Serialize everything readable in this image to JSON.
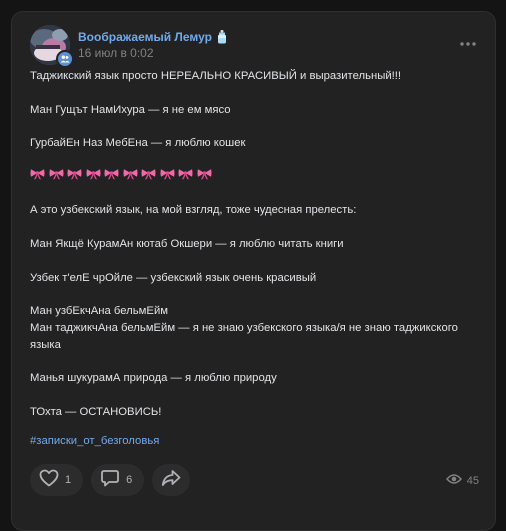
{
  "post": {
    "author": "Воображаемый Лемур",
    "author_emoji": "baby-bottle-icon",
    "date": "16 июл в 0:02",
    "lines": [
      "Таджикский язык просто НЕРЕАЛЬНО КРАСИВЫЙ и выразительный!!!",
      "",
      "Ман Гущът НамИхура — я не ем мясо",
      "",
      "ГурбайЕн Наз МебЕна — я люблю кошек",
      "",
      "",
      "",
      "А это узбекский язык, на мой взгляд, тоже чудесная прелесть:",
      "",
      "Ман Якщё КурамАн кютаб Окшери — я люблю читать книги",
      "",
      "Узбек т'елЕ чрОйле — узбекский язык очень красивый",
      "",
      "Ман узбЕкчАна бельмЕйм",
      "Ман таджикчАна бельмЕйм — я не знаю узбекского языка/я не знаю таджикского языка",
      "",
      "Манья шукурамА природа — я люблю природу",
      "",
      "ТОхта — ОСТАНОВИСЬ!"
    ],
    "bow_emoji": "ribbon-icon",
    "bow_count": 10,
    "hashtag": "#записки_от_безголовья"
  },
  "actions": {
    "likes": "1",
    "comments": "6",
    "views": "45"
  },
  "colors": {
    "accent": "#71aaeb",
    "background": "#141414",
    "card": "#222222",
    "text": "#e1e3e6",
    "muted": "#828282",
    "bow": "#f06aa8"
  }
}
